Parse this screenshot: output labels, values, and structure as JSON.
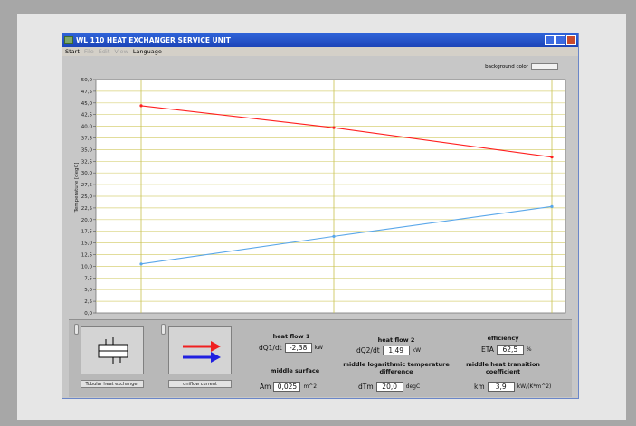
{
  "window": {
    "title": "WL 110 HEAT EXCHANGER SERVICE UNIT"
  },
  "menu": [
    {
      "label": "Start",
      "enabled": true
    },
    {
      "label": "File",
      "enabled": false
    },
    {
      "label": "Edit",
      "enabled": false
    },
    {
      "label": "View",
      "enabled": false
    },
    {
      "label": "Language",
      "enabled": true
    }
  ],
  "background_color": {
    "label": "background color"
  },
  "chart_data": {
    "type": "line",
    "ylabel": "Temperature [degC]",
    "ylim": [
      0,
      50
    ],
    "yticks": [
      "0,0",
      "2,5",
      "5,0",
      "7,5",
      "10,0",
      "12,5",
      "15,0",
      "17,5",
      "20,0",
      "22,5",
      "25,0",
      "27,5",
      "30,0",
      "32,5",
      "35,0",
      "37,5",
      "40,0",
      "42,5",
      "45,0",
      "47,5",
      "50,0"
    ],
    "x": [
      0,
      1,
      2
    ],
    "grid": true,
    "series": [
      {
        "color": "#ff2020",
        "values": [
          44.4,
          39.7,
          33.4
        ]
      },
      {
        "color": "#5aa7ea",
        "values": [
          10.5,
          16.4,
          22.8
        ]
      }
    ]
  },
  "icons": {
    "exchanger": {
      "name": "tubular-heat-exchanger-icon",
      "label": "Tubular heat exchanger"
    },
    "flow": {
      "name": "uniflow-current-icon",
      "label": "uniflow current"
    }
  },
  "heat_flow_1": {
    "title": "heat flow 1",
    "symbol": "dQ1/dt",
    "value": "-2,38",
    "unit": "kW"
  },
  "heat_flow_2": {
    "title": "heat flow 2",
    "symbol": "dQ2/dt",
    "value": "1,49",
    "unit": "kW"
  },
  "efficiency": {
    "title": "efficiency",
    "symbol": "ETA",
    "value": "62,5",
    "unit": "%"
  },
  "middle_surface": {
    "title": "middle surface",
    "symbol": "Am",
    "value": "0,025",
    "unit": "m^2"
  },
  "log_temp_diff": {
    "title": "middle logarithmic temperature difference",
    "symbol": "dTm",
    "value": "20,0",
    "unit": "degC"
  },
  "heat_transition": {
    "title": "middle heat transition coefficient",
    "symbol": "km",
    "value": "3,9",
    "unit": "kW/(K*m^2)"
  }
}
